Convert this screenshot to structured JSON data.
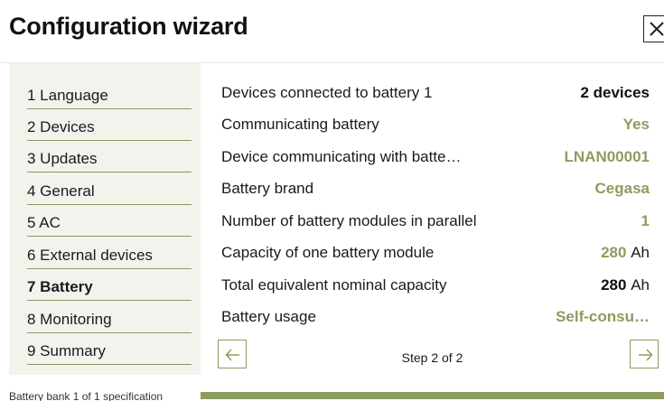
{
  "header": {
    "title": "Configuration wizard"
  },
  "sidebar": {
    "steps": [
      {
        "label": "1 Language"
      },
      {
        "label": "2 Devices"
      },
      {
        "label": "3 Updates"
      },
      {
        "label": "4 General"
      },
      {
        "label": "5 AC"
      },
      {
        "label": "6 External devices"
      },
      {
        "label": "7 Battery",
        "active": true
      },
      {
        "label": "8 Monitoring"
      },
      {
        "label": "9 Summary"
      }
    ]
  },
  "details": [
    {
      "label": "Devices connected to battery 1",
      "value": "2 devices",
      "unit": "",
      "style": "dark"
    },
    {
      "label": "Communicating battery",
      "value": "Yes",
      "unit": "",
      "style": "green"
    },
    {
      "label": "Device communicating with batte…",
      "value": "LNAN00001",
      "unit": "",
      "style": "green"
    },
    {
      "label": "Battery brand",
      "value": "Cegasa",
      "unit": "",
      "style": "green"
    },
    {
      "label": "Number of battery modules in parallel",
      "value": "1",
      "unit": "",
      "style": "green"
    },
    {
      "label": "Capacity of one battery module",
      "value": "280",
      "unit": "Ah",
      "style": "green"
    },
    {
      "label": "Total equivalent nominal capacity",
      "value": "280",
      "unit": "Ah",
      "style": "dark"
    },
    {
      "label": "Battery usage",
      "value": "Self-consu…",
      "unit": "",
      "style": "green"
    }
  ],
  "pagination": {
    "text": "Step 2 of 2"
  },
  "footer": {
    "label": "Battery bank 1 of 1 specification"
  },
  "colors": {
    "accent": "#8c9d5e",
    "sidebar_bg": "#f3f3ee",
    "text": "#1a1a1a"
  },
  "icons": {
    "close": "close-icon",
    "prev": "arrow-left-icon",
    "next": "arrow-right-icon"
  }
}
